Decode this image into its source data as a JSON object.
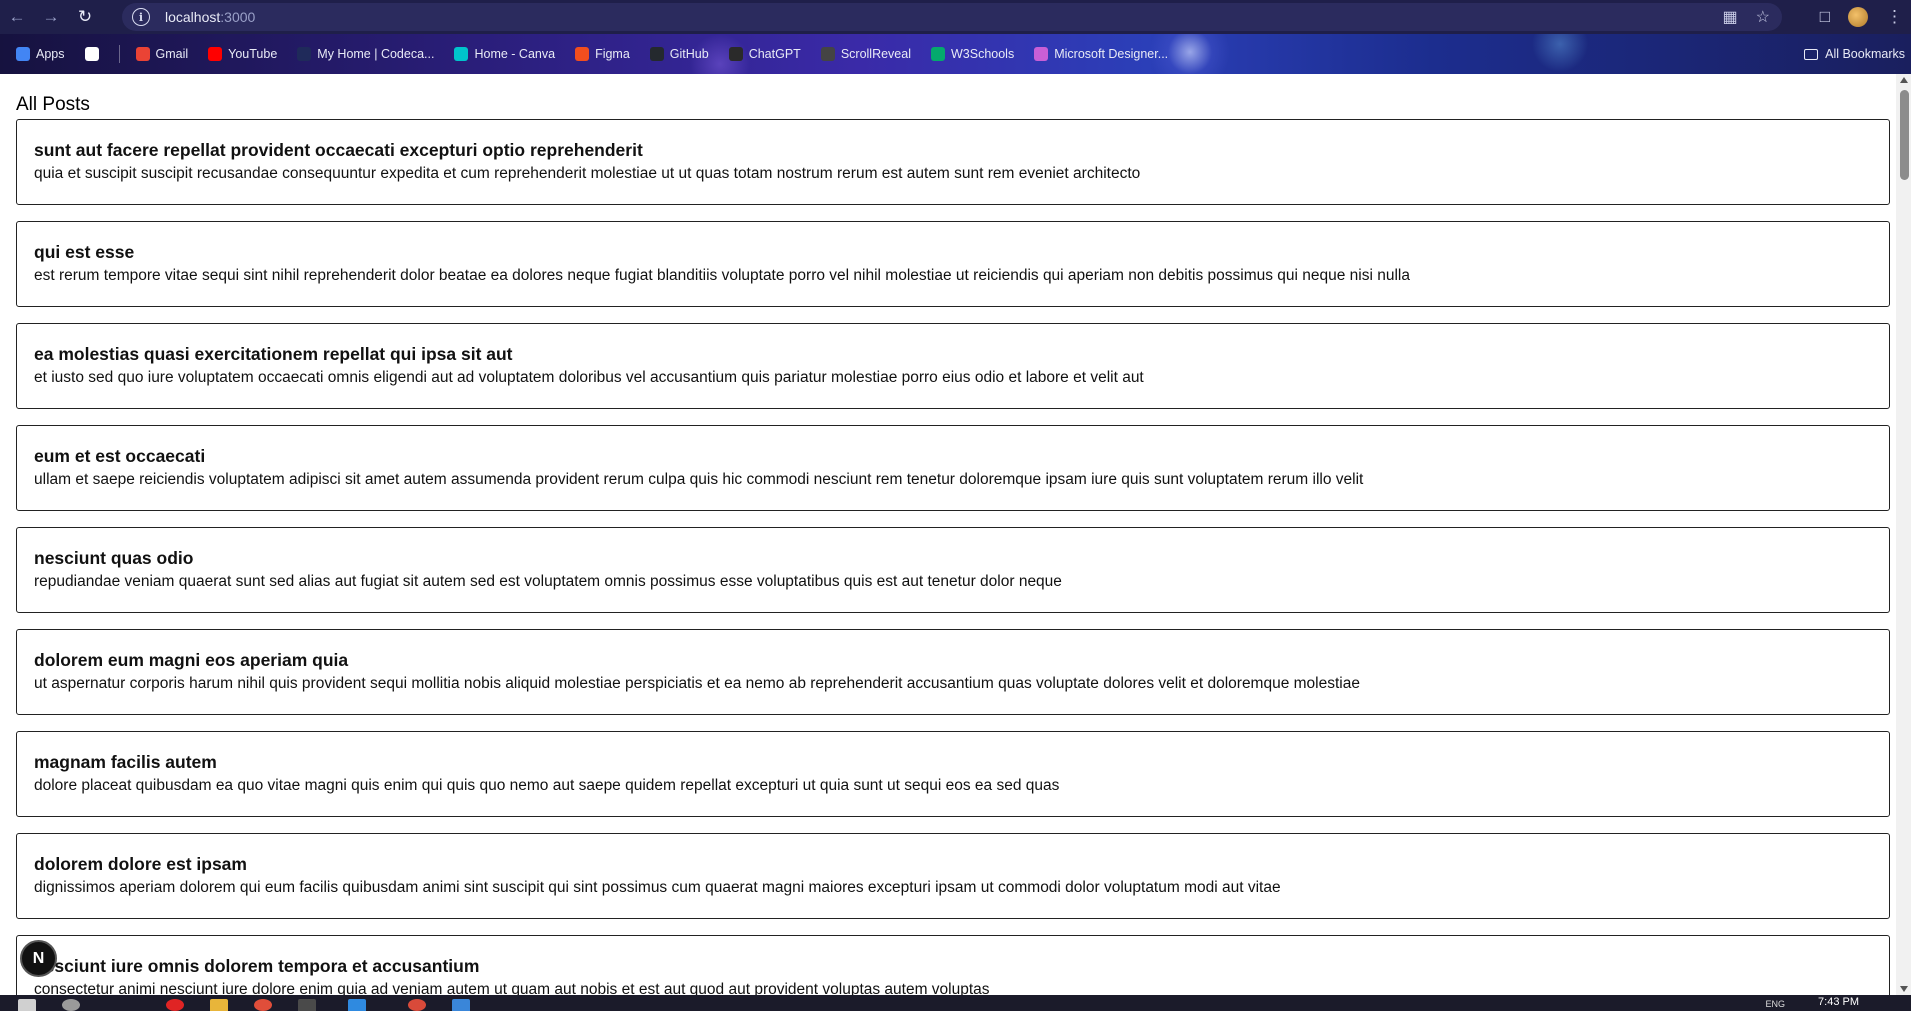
{
  "browser": {
    "url_host": "localhost",
    "url_port": ":3000"
  },
  "bookmarks": [
    {
      "label": "Apps",
      "icon": "apps-grid-icon",
      "color": "#4285f4"
    },
    {
      "label": "",
      "icon": "extensions-grid-icon",
      "color": "#ffffff"
    },
    {
      "label": "Gmail",
      "icon": "gmail-icon",
      "color": "#ea4335"
    },
    {
      "label": "YouTube",
      "icon": "youtube-icon",
      "color": "#ff0000"
    },
    {
      "label": "My Home | Codeca...",
      "icon": "codecademy-icon",
      "color": "#1f2a5a"
    },
    {
      "label": "Home - Canva",
      "icon": "canva-icon",
      "color": "#00c4cc"
    },
    {
      "label": "Figma",
      "icon": "figma-icon",
      "color": "#f24e1e"
    },
    {
      "label": "GitHub",
      "icon": "github-icon",
      "color": "#24292e"
    },
    {
      "label": "ChatGPT",
      "icon": "chatgpt-icon",
      "color": "#2a2a2a"
    },
    {
      "label": "ScrollReveal",
      "icon": "scrollreveal-icon",
      "color": "#444444"
    },
    {
      "label": "W3Schools",
      "icon": "w3schools-icon",
      "color": "#04aa6d"
    },
    {
      "label": "Microsoft Designer...",
      "icon": "designer-icon",
      "color": "#c85fd6"
    }
  ],
  "all_bookmarks_label": "All Bookmarks",
  "page": {
    "title": "All Posts"
  },
  "posts": [
    {
      "title": "sunt aut facere repellat provident occaecati excepturi optio reprehenderit",
      "body": "quia et suscipit suscipit recusandae consequuntur expedita et cum reprehenderit molestiae ut ut quas totam nostrum rerum est autem sunt rem eveniet architecto"
    },
    {
      "title": "qui est esse",
      "body": "est rerum tempore vitae sequi sint nihil reprehenderit dolor beatae ea dolores neque fugiat blanditiis voluptate porro vel nihil molestiae ut reiciendis qui aperiam non debitis possimus qui neque nisi nulla"
    },
    {
      "title": "ea molestias quasi exercitationem repellat qui ipsa sit aut",
      "body": "et iusto sed quo iure voluptatem occaecati omnis eligendi aut ad voluptatem doloribus vel accusantium quis pariatur molestiae porro eius odio et labore et velit aut"
    },
    {
      "title": "eum et est occaecati",
      "body": "ullam et saepe reiciendis voluptatem adipisci sit amet autem assumenda provident rerum culpa quis hic commodi nesciunt rem tenetur doloremque ipsam iure quis sunt voluptatem rerum illo velit"
    },
    {
      "title": "nesciunt quas odio",
      "body": "repudiandae veniam quaerat sunt sed alias aut fugiat sit autem sed est voluptatem omnis possimus esse voluptatibus quis est aut tenetur dolor neque"
    },
    {
      "title": "dolorem eum magni eos aperiam quia",
      "body": "ut aspernatur corporis harum nihil quis provident sequi mollitia nobis aliquid molestiae perspiciatis et ea nemo ab reprehenderit accusantium quas voluptate dolores velit et doloremque molestiae"
    },
    {
      "title": "magnam facilis autem",
      "body": "dolore placeat quibusdam ea quo vitae magni quis enim qui quis quo nemo aut saepe quidem repellat excepturi ut quia sunt ut sequi eos ea sed quas"
    },
    {
      "title": "dolorem dolore est ipsam",
      "body": "dignissimos aperiam dolorem qui eum facilis quibusdam animi sint suscipit qui sint possimus cum quaerat magni maiores excepturi ipsam ut commodi dolor voluptatum modi aut vitae"
    },
    {
      "title": "nesciunt iure omnis dolorem tempora et accusantium",
      "body": "consectetur animi nesciunt iure dolore enim quia ad veniam autem ut quam aut nobis et est aut quod aut provident voluptas autem voluptas"
    }
  ],
  "next_badge": "N",
  "taskbar": {
    "time": "7:43 PM",
    "lang": "ENG"
  }
}
